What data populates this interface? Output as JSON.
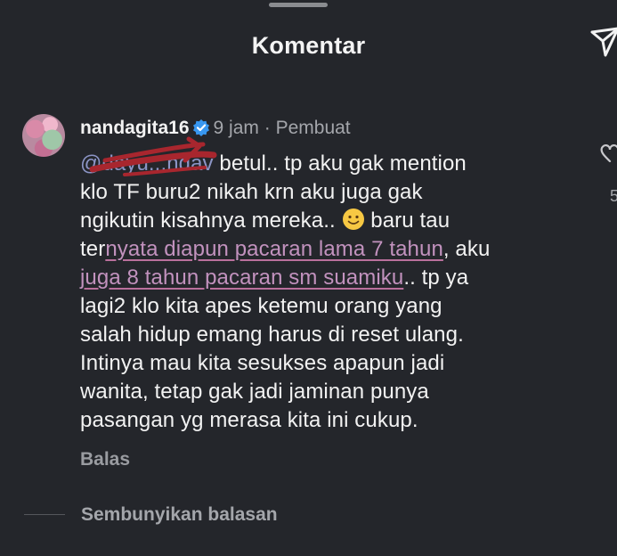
{
  "header": {
    "title": "Komentar"
  },
  "comment": {
    "username": "nandagita16",
    "time": "9 jam",
    "separator": "·",
    "role": "Pembuat",
    "mention": "@dayu...ndav",
    "lines": [
      {
        "a": " betul.. tp aku gak mention"
      },
      {
        "a": "klo TF buru2 nikah krn aku juga gak"
      },
      {
        "a": "ngikutin kisahnya mereka.. ",
        "b": " baru tau"
      },
      {
        "pre": "ter",
        "hl": "nyata diapun pacaran lama 7 tahun",
        "post": ", aku"
      },
      {
        "hl": "juga 8 tahun pacaran sm suamiku",
        "post": ".. tp ya"
      },
      {
        "a": "lagi2 klo kita apes ketemu orang yang"
      },
      {
        "a": "salah hidup emang harus di reset ulang."
      },
      {
        "a": "Intinya mau kita sesukses apapun jadi"
      },
      {
        "a": "wanita, tetap gak jadi jaminan punya"
      },
      {
        "a": "pasangan yg merasa kita ini cukup."
      }
    ],
    "emoji_icon": "slightly-smiling-face",
    "reply_label": "Balas",
    "hide_replies_label": "Sembunyikan balasan",
    "like_count": "5"
  },
  "icons": {
    "send": "send-icon",
    "verified": "verified-badge-icon",
    "like": "heart-icon"
  },
  "colors": {
    "background": "#24262b",
    "mention": "#8c95c6",
    "highlight": "#c292be",
    "scribble": "#a8262e",
    "verified": "#3897f0"
  }
}
